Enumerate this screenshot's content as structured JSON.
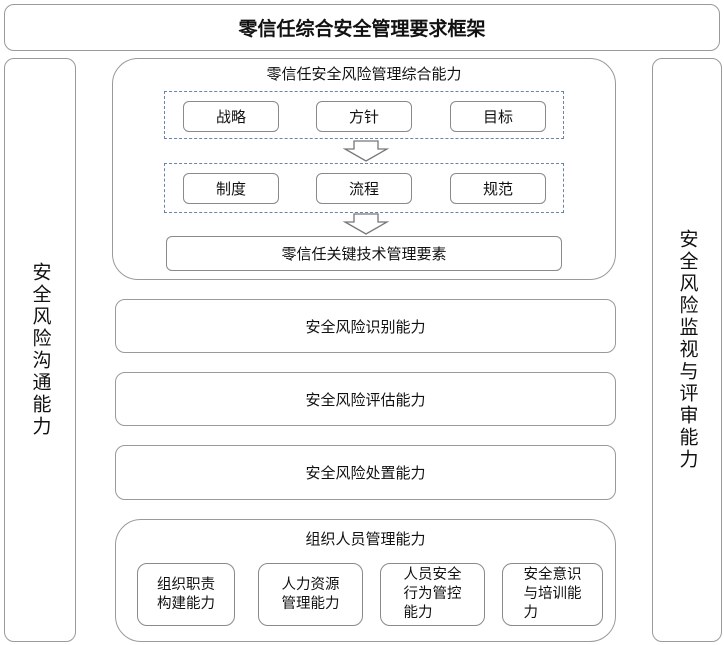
{
  "title": "零信任综合安全管理要求框架",
  "left_column": "安全风险沟通能力",
  "right_column": "安全风险监视与评审能力",
  "top_group": {
    "title": "零信任安全风险管理综合能力",
    "row1": [
      "战略",
      "方针",
      "目标"
    ],
    "row2": [
      "制度",
      "流程",
      "规范"
    ],
    "bottom": "零信任关键技术管理要素"
  },
  "capabilities": [
    "安全风险识别能力",
    "安全风险评估能力",
    "安全风险处置能力"
  ],
  "org_group": {
    "title": "组织人员管理能力",
    "items": [
      {
        "lines": [
          "组织职责",
          "构建能力"
        ]
      },
      {
        "lines": [
          "人力资源",
          "管理能力"
        ]
      },
      {
        "lines": [
          "人员安全",
          "行为管控",
          "能力"
        ]
      },
      {
        "lines": [
          "安全意识",
          "与培训能",
          "力"
        ]
      }
    ]
  }
}
